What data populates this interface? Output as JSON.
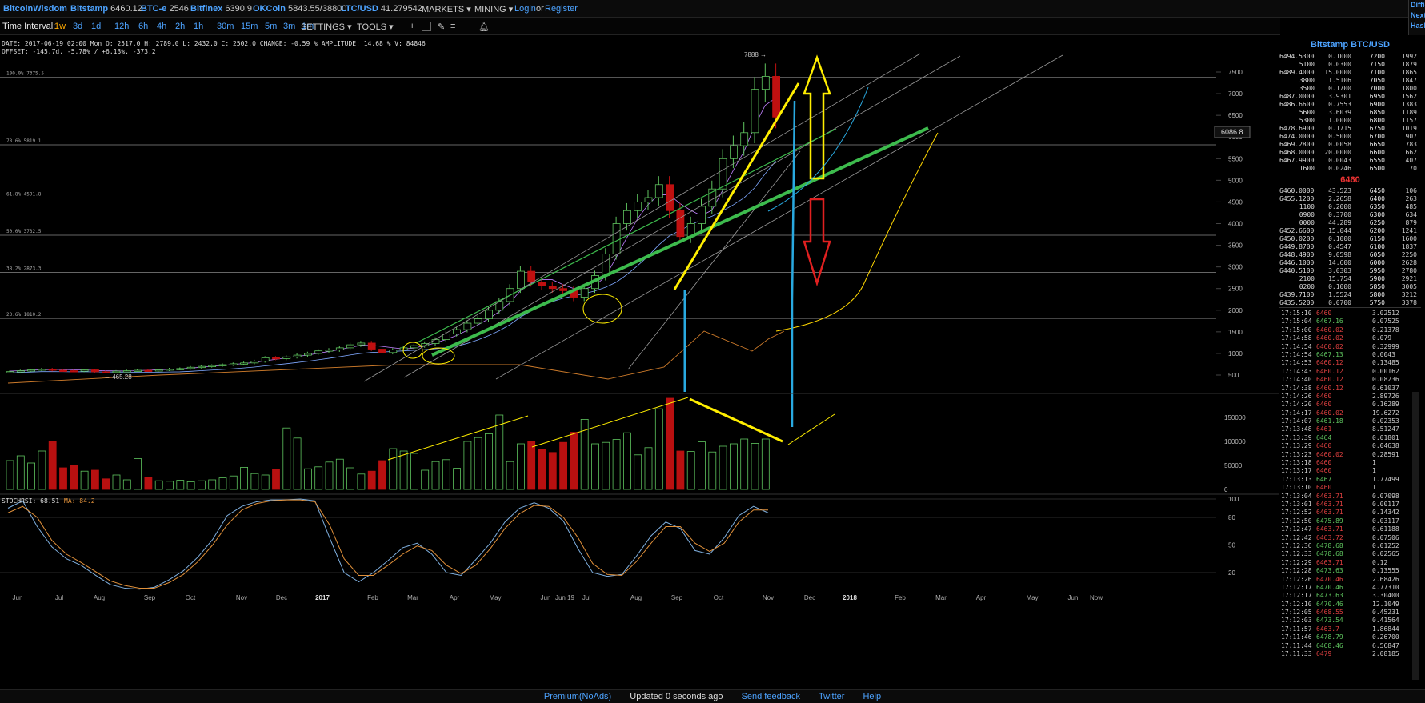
{
  "topbar": {
    "brand": "BitcoinWisdom",
    "tickers": [
      {
        "name": "Bitstamp",
        "value": "6460.12"
      },
      {
        "name": "BTC-e",
        "value": "2546"
      },
      {
        "name": "Bitfinex",
        "value": "6390.9"
      },
      {
        "name": "OKCoin",
        "value": "5843.55/38800"
      },
      {
        "name": "LTC/USD",
        "value": "41.279542"
      }
    ],
    "menus": [
      "MARKETS",
      "MINING"
    ],
    "login": "Login",
    "or": "or",
    "register": "Register",
    "right_edge": [
      "Diffic",
      "Next",
      "Hash"
    ]
  },
  "toolbar": {
    "label": "Time Interval:",
    "intervals": [
      "1w",
      "3d",
      "1d",
      "12h",
      "6h",
      "4h",
      "2h",
      "1h",
      "30m",
      "15m",
      "5m",
      "3m",
      "1m"
    ],
    "active_interval": "1w",
    "settings": "SETTINGS",
    "tools": "TOOLS"
  },
  "info": {
    "line1": "DATE: 2017-06-19 02:00 Mon   O: 2517.0   H: 2789.0   L: 2432.0   C: 2502.0   CHANGE: -0.59 %   AMPLITUDE: 14.68 %   V: 84846",
    "line2": "OFFSET: -145.7d, -5.78% / +6.13%, -373.2"
  },
  "chart_data": {
    "type": "candlestick",
    "price_axis": {
      "min": 0,
      "max": 8000,
      "ticks": [
        500,
        1000,
        1500,
        2000,
        2500,
        3000,
        3500,
        4000,
        4500,
        5000,
        5500,
        6000,
        6500,
        7000,
        7500
      ]
    },
    "volume_axis": {
      "min": 0,
      "max": 200000,
      "ticks": [
        0,
        50000,
        100000,
        150000
      ]
    },
    "stoch_axis": {
      "min": 0,
      "max": 100,
      "ticks": [
        20,
        50,
        80,
        100
      ]
    },
    "x_labels": [
      "Jun",
      "Jul",
      "Aug",
      "Sep",
      "Oct",
      "Nov",
      "Dec",
      "2017",
      "Feb",
      "Mar",
      "Apr",
      "May",
      "Jun",
      "Jun 19",
      "Jul",
      "Aug",
      "Sep",
      "Oct",
      "Nov",
      "Dec",
      "2018",
      "Feb",
      "Mar",
      "Apr",
      "May",
      "Jun",
      "Now"
    ],
    "fib_levels": [
      {
        "label": "100.0% 7375.5",
        "value": 7375.5
      },
      {
        "label": "78.6% 5819.1",
        "value": 5819.1
      },
      {
        "label": "61.8% 4591.8",
        "value": 4591.8
      },
      {
        "label": "50.0% 3732.5",
        "value": 3732.5
      },
      {
        "label": "38.2% 2873.3",
        "value": 2873.3
      },
      {
        "label": "23.6% 1810.2",
        "value": 1810.2
      }
    ],
    "high_label": "7888",
    "low_label": "465.28",
    "current_price_label": "6086.8",
    "stochrsi_label": "STOCHRSI: 68.51",
    "ma_label": "MA: 84.2",
    "closes": [
      580,
      600,
      620,
      640,
      610,
      600,
      590,
      620,
      575,
      560,
      590,
      600,
      610,
      605,
      620,
      640,
      650,
      680,
      700,
      720,
      740,
      760,
      780,
      820,
      900,
      880,
      920,
      960,
      1000,
      1060,
      1080,
      1130,
      1200,
      1240,
      1100,
      1020,
      1080,
      1130,
      1180,
      1230,
      1320,
      1450,
      1550,
      1700,
      1800,
      2000,
      2200,
      2500,
      2900,
      2650,
      2560,
      2500,
      2450,
      2300,
      2500,
      2800,
      3300,
      4000,
      4300,
      4500,
      4600,
      4900,
      4300,
      3700,
      4000,
      4400,
      4800,
      5500,
      5800,
      6100,
      7100,
      7400,
      6460
    ],
    "volumes": [
      60000,
      70000,
      55000,
      80000,
      100000,
      45000,
      50000,
      38000,
      40000,
      22000,
      30000,
      20000,
      64000,
      26000,
      18000,
      17000,
      19000,
      16000,
      18000,
      20000,
      24000,
      28000,
      46000,
      33000,
      30000,
      42000,
      128000,
      107000,
      43000,
      47000,
      57000,
      63000,
      45000,
      32000,
      38000,
      60000,
      85000,
      80000,
      75000,
      40000,
      58000,
      62000,
      44000,
      100000,
      108000,
      116000,
      155000,
      58000,
      95000,
      100000,
      84000,
      77000,
      98000,
      119000,
      146000,
      95000,
      98000,
      104000,
      118000,
      72000,
      87000,
      168000,
      190000,
      80000,
      79000,
      99000,
      78000,
      90000,
      95000,
      105000,
      96000,
      105000
    ],
    "stoch_k": [
      90,
      98,
      70,
      48,
      35,
      28,
      17,
      7,
      3,
      2,
      4,
      12,
      22,
      37,
      56,
      82,
      92,
      97,
      99,
      99,
      100,
      98,
      58,
      20,
      10,
      20,
      33,
      47,
      52,
      40,
      20,
      17,
      34,
      52,
      75,
      90,
      96,
      90,
      76,
      46,
      20,
      16,
      18,
      38,
      60,
      75,
      68,
      44,
      40,
      58,
      82,
      92,
      85
    ],
    "stoch_d": [
      85,
      92,
      80,
      55,
      40,
      31,
      21,
      11,
      6,
      3,
      3,
      9,
      18,
      32,
      50,
      72,
      88,
      95,
      98,
      99,
      99,
      97,
      72,
      35,
      17,
      17,
      28,
      40,
      49,
      44,
      28,
      19,
      28,
      46,
      68,
      84,
      93,
      92,
      80,
      58,
      30,
      18,
      17,
      32,
      52,
      70,
      70,
      52,
      43,
      52,
      75,
      88,
      88
    ]
  },
  "sidebar": {
    "title": "Bitstamp BTC/USD",
    "asks": [
      [
        "6494.53000",
        "0.1000",
        "7200",
        "1992"
      ],
      [
        "5100",
        "0.0300",
        "7150",
        "1879"
      ],
      [
        "6489.40000",
        "15.0000",
        "7100",
        "1865"
      ],
      [
        "3800",
        "1.5106",
        "7050",
        "1847"
      ],
      [
        "3500",
        "0.1700",
        "7000",
        "1800"
      ],
      [
        "6487.00000",
        "3.9301",
        "6950",
        "1562"
      ],
      [
        "6486.66000",
        "0.7553",
        "6900",
        "1383"
      ],
      [
        "5600",
        "3.6039",
        "6850",
        "1189"
      ],
      [
        "5300",
        "1.0000",
        "6800",
        "1157"
      ],
      [
        "6478.69000",
        "0.1715",
        "6750",
        "1019"
      ],
      [
        "6474.00000",
        "0.5000",
        "6700",
        "907"
      ],
      [
        "6469.28000",
        "0.0058",
        "6650",
        "783"
      ],
      [
        "6468.00000",
        "20.0000",
        "6600",
        "662"
      ],
      [
        "6467.99000",
        "0.0043",
        "6550",
        "407"
      ],
      [
        "1600",
        "0.0246",
        "6500",
        "70"
      ]
    ],
    "mid_price": "6460",
    "bids": [
      [
        "6460.00000",
        "43.523",
        "6450",
        "106"
      ],
      [
        "6455.12000",
        "2.2658",
        "6400",
        "263"
      ],
      [
        "1100",
        "0.2000",
        "6350",
        "485"
      ],
      [
        "0900",
        "0.3700",
        "6300",
        "634"
      ],
      [
        "0000",
        "44.289",
        "6250",
        "879"
      ],
      [
        "6452.66000",
        "15.044",
        "6200",
        "1241"
      ],
      [
        "6450.02000",
        "0.1000",
        "6150",
        "1600"
      ],
      [
        "6449.87000",
        "0.4547",
        "6100",
        "1837"
      ],
      [
        "6448.49000",
        "9.0598",
        "6050",
        "2250"
      ],
      [
        "6446.10000",
        "14.600",
        "6000",
        "2628"
      ],
      [
        "6440.51000",
        "3.0303",
        "5950",
        "2780"
      ],
      [
        "2100",
        "15.754",
        "5900",
        "2921"
      ],
      [
        "0200",
        "0.1000",
        "5850",
        "3005"
      ],
      [
        "6439.71000",
        "1.5524",
        "5800",
        "3212"
      ],
      [
        "6435.52000",
        "0.0700",
        "5750",
        "3378"
      ]
    ],
    "trades": [
      [
        "17:15:10",
        "6460",
        "3.02512",
        "r"
      ],
      [
        "17:15:04",
        "6467.16",
        "0.07525",
        "g"
      ],
      [
        "17:15:00",
        "6460.02",
        "0.21378",
        "r"
      ],
      [
        "17:14:58",
        "6460.02",
        "0.079",
        "r"
      ],
      [
        "17:14:54",
        "6460.02",
        "0.32999",
        "r"
      ],
      [
        "17:14:54",
        "6467.13",
        "0.0043",
        "g"
      ],
      [
        "17:14:53",
        "6460.12",
        "0.13485",
        "r"
      ],
      [
        "17:14:43",
        "6460.12",
        "0.00162",
        "r"
      ],
      [
        "17:14:40",
        "6460.12",
        "0.08236",
        "r"
      ],
      [
        "17:14:38",
        "6460.12",
        "0.61037",
        "r"
      ],
      [
        "17:14:26",
        "6460",
        "2.89726",
        "r"
      ],
      [
        "17:14:20",
        "6460",
        "0.16289",
        "r"
      ],
      [
        "17:14:17",
        "6460.02",
        "19.6272",
        "r"
      ],
      [
        "17:14:07",
        "6461.18",
        "0.02353",
        "g"
      ],
      [
        "17:13:48",
        "6461",
        "8.51247",
        "r"
      ],
      [
        "17:13:39",
        "6464",
        "0.01801",
        "g"
      ],
      [
        "17:13:29",
        "6460",
        "0.04638",
        "r"
      ],
      [
        "17:13:23",
        "6460.02",
        "0.28591",
        "r"
      ],
      [
        "17:13:18",
        "6460",
        "1",
        "r"
      ],
      [
        "17:13:17",
        "6460",
        "1",
        "r"
      ],
      [
        "17:13:13",
        "6467",
        "1.77499",
        "g"
      ],
      [
        "17:13:10",
        "6460",
        "1",
        "r"
      ],
      [
        "17:13:04",
        "6463.71",
        "0.07098",
        "r"
      ],
      [
        "17:13:01",
        "6463.71",
        "0.00117",
        "r"
      ],
      [
        "17:12:52",
        "6463.71",
        "0.14342",
        "r"
      ],
      [
        "17:12:50",
        "6475.89",
        "0.03117",
        "g"
      ],
      [
        "17:12:47",
        "6463.71",
        "0.61188",
        "r"
      ],
      [
        "17:12:42",
        "6463.72",
        "0.07506",
        "r"
      ],
      [
        "17:12:36",
        "6478.68",
        "0.01252",
        "g"
      ],
      [
        "17:12:33",
        "6478.68",
        "0.02565",
        "g"
      ],
      [
        "17:12:29",
        "6463.71",
        "0.12",
        "r"
      ],
      [
        "17:12:28",
        "6473.63",
        "0.13555",
        "g"
      ],
      [
        "17:12:26",
        "6470.46",
        "2.68426",
        "r"
      ],
      [
        "17:12:17",
        "6470.46",
        "4.77310",
        "g"
      ],
      [
        "17:12:17",
        "6473.63",
        "3.30400",
        "g"
      ],
      [
        "17:12:10",
        "6470.46",
        "12.1049",
        "g"
      ],
      [
        "17:12:05",
        "6468.55",
        "0.45231",
        "r"
      ],
      [
        "17:12:03",
        "6473.54",
        "0.41564",
        "g"
      ],
      [
        "17:11:57",
        "6463.7",
        "1.86844",
        "r"
      ],
      [
        "17:11:46",
        "6478.79",
        "0.26700",
        "g"
      ],
      [
        "17:11:44",
        "6468.46",
        "6.56847",
        "g"
      ],
      [
        "17:11:33",
        "6479",
        "2.08185",
        "r"
      ]
    ]
  },
  "footer": [
    "Premium(NoAds)",
    "Updated 0 seconds ago",
    "Send feedback",
    "Twitter",
    "Help"
  ],
  "colors": {
    "up": "#5fc55f",
    "down": "#c01010",
    "accent": "#4da3ff",
    "annotation_yellow": "#ffee00",
    "annotation_green": "#3dbb4d",
    "annotation_blue": "#29a9e0",
    "annotation_red": "#e02020"
  }
}
